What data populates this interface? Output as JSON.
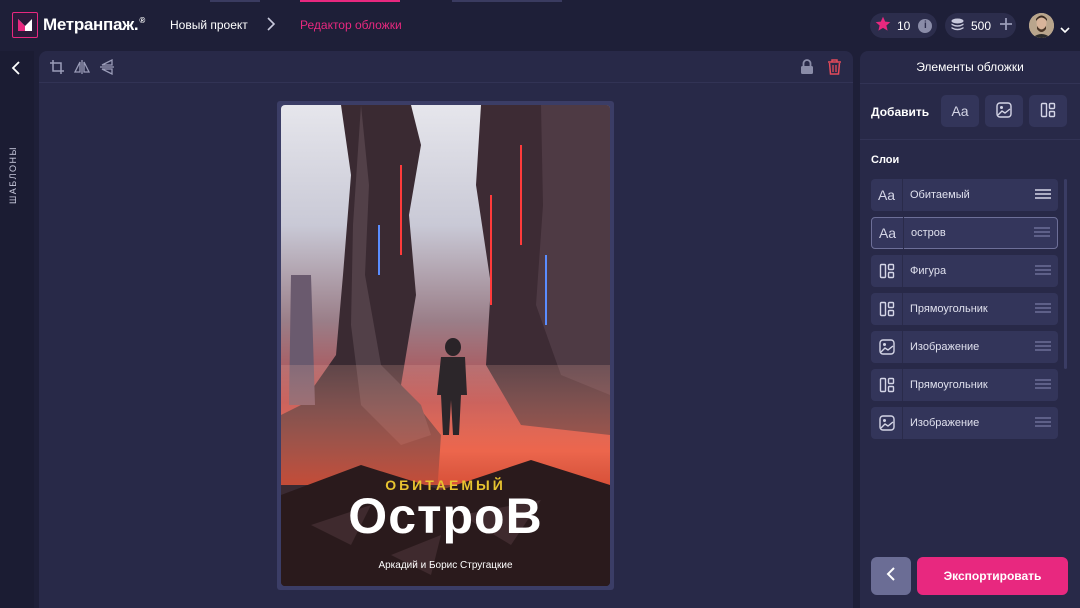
{
  "app": {
    "brand": "Метранпаж.",
    "brand_reg": "®"
  },
  "header": {
    "breadcrumbs": [
      {
        "label": "Новый проект"
      },
      {
        "label": "Редактор обложки",
        "active": true
      }
    ],
    "stars": "10",
    "coins": "500"
  },
  "left_rail": {
    "label": "ШАБЛОНЫ"
  },
  "cover": {
    "subtitle": "ОБИТАЕМЫЙ",
    "title": "ОстроВ",
    "author": "Аркадий и Борис Стругацкие"
  },
  "panel": {
    "title": "Элементы обложки",
    "add_label": "Добавить",
    "add_text_label": "Aa",
    "layers_label": "Слои",
    "layers": [
      {
        "type": "text",
        "icon": "text-icon",
        "icon_text": "Aa",
        "label": "Обитаемый"
      },
      {
        "type": "text",
        "icon": "text-icon",
        "icon_text": "Aa",
        "label": "остров",
        "active": true
      },
      {
        "type": "shape",
        "icon": "shape-icon",
        "label": "Фигура"
      },
      {
        "type": "shape",
        "icon": "shape-icon",
        "label": "Прямоугольник"
      },
      {
        "type": "image",
        "icon": "image-icon",
        "label": "Изображение"
      },
      {
        "type": "shape",
        "icon": "shape-icon",
        "label": "Прямоугольник"
      },
      {
        "type": "image",
        "icon": "image-icon",
        "label": "Изображение"
      }
    ],
    "export_label": "Экспортировать"
  },
  "colors": {
    "accent": "#e8287f",
    "background": "#1e1f38",
    "panel": "#282948",
    "subtitle_gold": "#e8c430"
  }
}
